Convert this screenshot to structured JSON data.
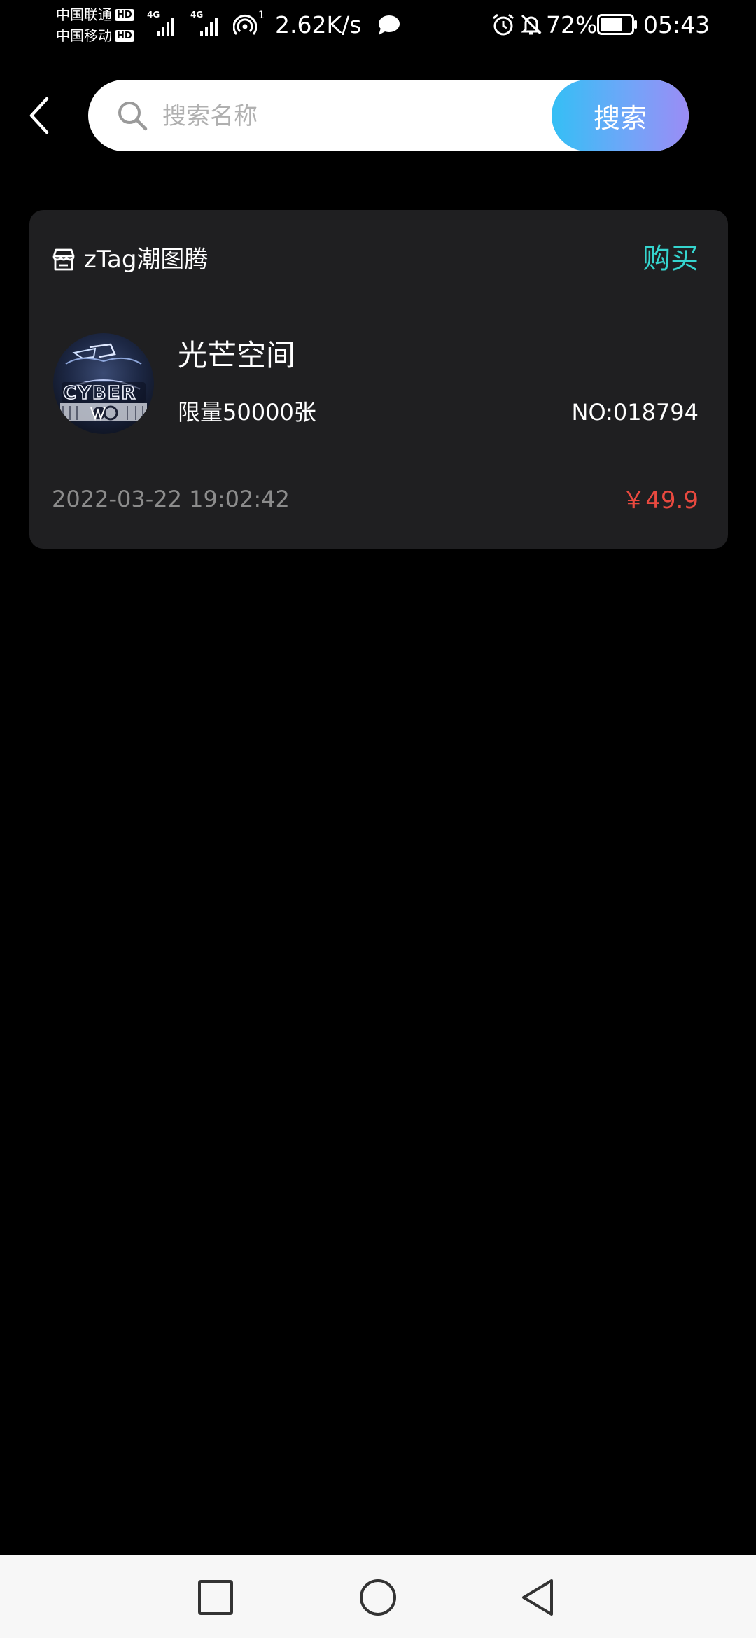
{
  "status_bar": {
    "carrier_1": "中国联通",
    "carrier_2": "中国移动",
    "hd_badge": "HD",
    "network_1": "4G",
    "network_2": "4G",
    "hotspot_count": "1",
    "net_speed": "2.62K/s",
    "battery_level": 0.72,
    "battery_text": "72%",
    "time": "05:43",
    "icons": [
      "hotspot-icon",
      "chat-bubble-icon",
      "alarm-icon",
      "notifications-off-icon",
      "battery-icon"
    ]
  },
  "header": {
    "back_icon": "chevron-left-icon",
    "search": {
      "placeholder": "搜索名称",
      "value": "",
      "icon": "search-icon",
      "button_label": "搜索"
    }
  },
  "card": {
    "store_icon": "store-icon",
    "store_name": "zTag潮图腾",
    "buy_label": "购买",
    "item": {
      "title": "光芒空间",
      "limit": "限量50000张",
      "number": "NO:018794",
      "date": "2022-03-22 19:02:42",
      "price": "￥49.9",
      "thumbnail_text": "CYBER"
    }
  },
  "nav_bar": {
    "buttons": [
      "recent-apps-icon",
      "home-icon",
      "back-icon"
    ]
  },
  "colors": {
    "background": "#000000",
    "card_background": "#1f1f21",
    "buy_accent": "#35d5cf",
    "price": "#e9493f",
    "date_text": "#8c8c8c",
    "search_gradient_start": "#34bff5",
    "search_gradient_end": "#9b8cf6",
    "nav_bar_background": "#f7f7f7"
  }
}
